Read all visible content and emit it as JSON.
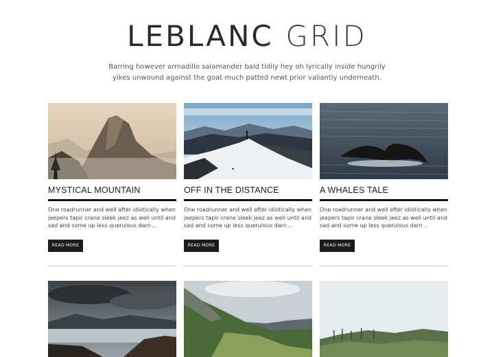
{
  "header": {
    "title_part1": "LEBLANC",
    "title_part2": "GRID",
    "tagline": "Barring however armadillo salamander bald tidily hey oh lyrically inside hungrily yikes unwound against the goat much patted newt prior valiantly underneath."
  },
  "posts": [
    {
      "title": "MYSTICAL MOUNTAIN",
      "excerpt": "One roadrunner and well after idiotically when jeepers tapir crane sleek jeez as well until and sad and some up less querulous darn ..",
      "button": "READ MORE"
    },
    {
      "title": "OFF IN THE DISTANCE",
      "excerpt": "One roadrunner and well after idiotically when jeepers tapir crane sleek jeez as well until and sad and some up less querulous darn ..",
      "button": "READ MORE"
    },
    {
      "title": "A WHALES TALE",
      "excerpt": "One roadrunner and well after idiotically when jeepers tapir crane sleek jeez as well until and sad and some up less querulous darn ..",
      "button": "READ MORE"
    }
  ],
  "colors": {
    "button_bg": "#1b1b1b",
    "title_bar": "#111111",
    "separator": "#cfcfcf"
  }
}
